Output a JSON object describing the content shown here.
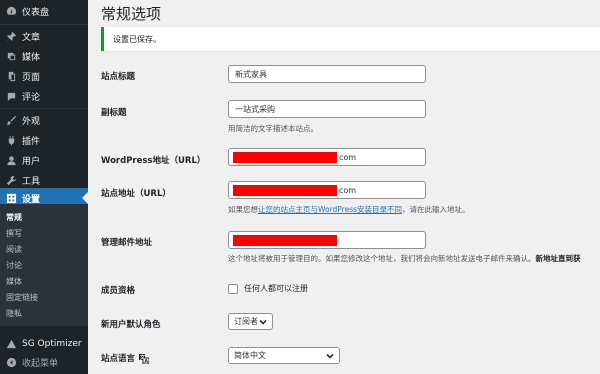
{
  "sidebar": {
    "items": [
      {
        "label": "仪表盘",
        "icon": "dashboard-icon"
      },
      {
        "label": "文章",
        "icon": "pin-icon"
      },
      {
        "label": "媒体",
        "icon": "media-icon"
      },
      {
        "label": "页面",
        "icon": "pages-icon"
      },
      {
        "label": "评论",
        "icon": "comment-icon"
      },
      {
        "label": "外观",
        "icon": "brush-icon"
      },
      {
        "label": "插件",
        "icon": "plugin-icon"
      },
      {
        "label": "用户",
        "icon": "user-icon"
      },
      {
        "label": "工具",
        "icon": "wrench-icon"
      },
      {
        "label": "设置",
        "icon": "settings-icon"
      }
    ],
    "submenu": [
      "常规",
      "撰写",
      "阅读",
      "讨论",
      "媒体",
      "固定链接",
      "隐私"
    ],
    "plugin_item": "SG Optimizer",
    "collapse_label": "收起菜单"
  },
  "page": {
    "title": "常规选项",
    "notice": "设置已保存。"
  },
  "form": {
    "site_title": {
      "label": "站点标题",
      "value": "新式家具"
    },
    "tagline": {
      "label": "副标题",
      "value": "一站式采购",
      "description": "用简洁的文字描述本站点。"
    },
    "wp_url": {
      "label": "WordPress地址（URL）",
      "suffix": "com"
    },
    "site_url": {
      "label": "站点地址（URL）",
      "suffix": "com",
      "desc_prefix": "如果您想",
      "desc_link": "让您的站点主页与WordPress安装目录不同",
      "desc_suffix": "，请在此输入地址。"
    },
    "admin_email": {
      "label": "管理邮件地址",
      "desc_main": "这个地址将被用于管理目的。如果您修改这个地址，我们将会向新地址发送电子邮件来确认。",
      "desc_bold": "新地址直到获"
    },
    "membership": {
      "label": "成员资格",
      "checkbox_label": "任何人都可以注册",
      "checked": false
    },
    "default_role": {
      "label": "新用户默认角色",
      "value": "订阅者"
    },
    "site_language": {
      "label": "站点语言",
      "value": "简体中文"
    }
  },
  "colors": {
    "sidebar_bg": "#1d2327",
    "accent": "#2271b1",
    "notice_border": "#00a32a",
    "redaction": "#ff0000"
  }
}
